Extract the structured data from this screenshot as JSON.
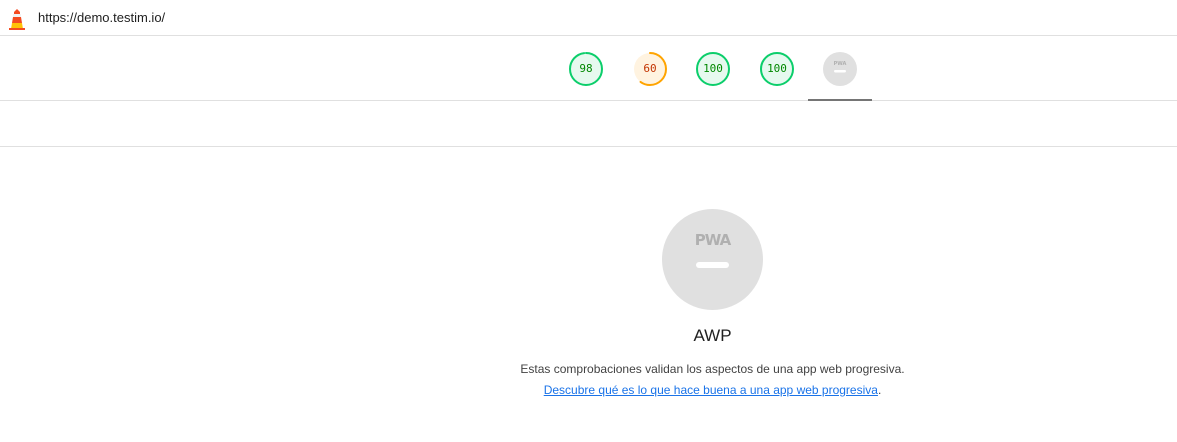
{
  "header": {
    "url": "https://demo.testim.io/"
  },
  "gauges": [
    {
      "label": "98",
      "score": 98,
      "color": "#0cce6b",
      "fill": "#e6f9ef",
      "text_color": "#008800"
    },
    {
      "label": "60",
      "score": 60,
      "color": "#ffa400",
      "fill": "#fff3e0",
      "text_color": "#c33300"
    },
    {
      "label": "100",
      "score": 100,
      "color": "#0cce6b",
      "fill": "#e6f9ef",
      "text_color": "#008800"
    },
    {
      "label": "100",
      "score": 100,
      "color": "#0cce6b",
      "fill": "#e6f9ef",
      "text_color": "#008800"
    }
  ],
  "pwa_badge": {
    "letters": "PWA"
  },
  "category": {
    "title": "AWP",
    "description": "Estas comprobaciones validan los aspectos de una app web progresiva.",
    "link_text": "Descubre qué es lo que hace buena a una app web progresiva",
    "link_suffix": "."
  },
  "colors": {
    "pass": "#0cce6b",
    "average": "#ffa400",
    "pwa_gray": "#e0e0e0",
    "link": "#1a73e8"
  }
}
